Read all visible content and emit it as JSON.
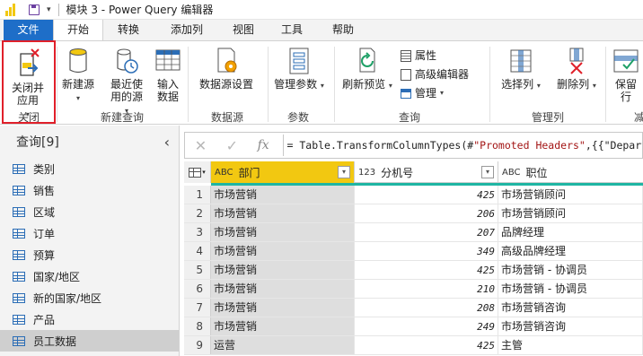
{
  "titlebar": {
    "title": "模块 3 - Power Query 编辑器"
  },
  "tabs": [
    {
      "label": "文件"
    },
    {
      "label": "开始"
    },
    {
      "label": "转换"
    },
    {
      "label": "添加列"
    },
    {
      "label": "视图"
    },
    {
      "label": "工具"
    },
    {
      "label": "帮助"
    }
  ],
  "ribbon": {
    "close_apply": "关闭并\n应用",
    "new_source": "新建源",
    "recent_sources": "最近使\n用的源",
    "enter_data": "输入\n数据",
    "data_source_settings": "数据源设置",
    "manage_params": "管理参数",
    "refresh_preview": "刷新预览",
    "properties": "属性",
    "advanced_editor": "高级编辑器",
    "manage": "管理",
    "choose_columns": "选择列",
    "remove_columns": "删除列",
    "keep_rows": "保留\n行",
    "groups": {
      "close": "关闭",
      "new_query": "新建查询",
      "data_sources": "数据源",
      "parameters": "参数",
      "query": "查询",
      "manage_columns": "管理列",
      "cut": "减"
    }
  },
  "queries": {
    "header": "查询[9]",
    "items": [
      "类别",
      "销售",
      "区域",
      "订单",
      "预算",
      "国家/地区",
      "新的国家/地区",
      "产品",
      "员工数据"
    ],
    "selected_index": 8
  },
  "formula": {
    "text_prefix": "= Table.TransformColumnTypes(#",
    "text_str": "\"Promoted Headers\"",
    "text_suffix": ",{{\"Departm"
  },
  "grid": {
    "columns": [
      {
        "type": "ABC",
        "name": "部门"
      },
      {
        "type": "123",
        "name": "分机号"
      },
      {
        "type": "ABC",
        "name": "职位"
      }
    ],
    "rows": [
      [
        "1",
        "市场营销",
        "425",
        "市场营销顾问"
      ],
      [
        "2",
        "市场营销",
        "206",
        "市场营销顾问"
      ],
      [
        "3",
        "市场营销",
        "207",
        "品牌经理"
      ],
      [
        "4",
        "市场营销",
        "349",
        "高级品牌经理"
      ],
      [
        "5",
        "市场营销",
        "425",
        "市场营销 - 协调员"
      ],
      [
        "6",
        "市场营销",
        "210",
        "市场营销 - 协调员"
      ],
      [
        "7",
        "市场营销",
        "208",
        "市场营销咨询"
      ],
      [
        "8",
        "市场营销",
        "249",
        "市场营销咨询"
      ],
      [
        "9",
        "运营",
        "425",
        "主管"
      ]
    ]
  },
  "colors": {
    "accent": "#f2c811",
    "file_tab": "#1e6ec8",
    "highlight": "#e0202a",
    "quality_bar": "#1fb5a3"
  }
}
